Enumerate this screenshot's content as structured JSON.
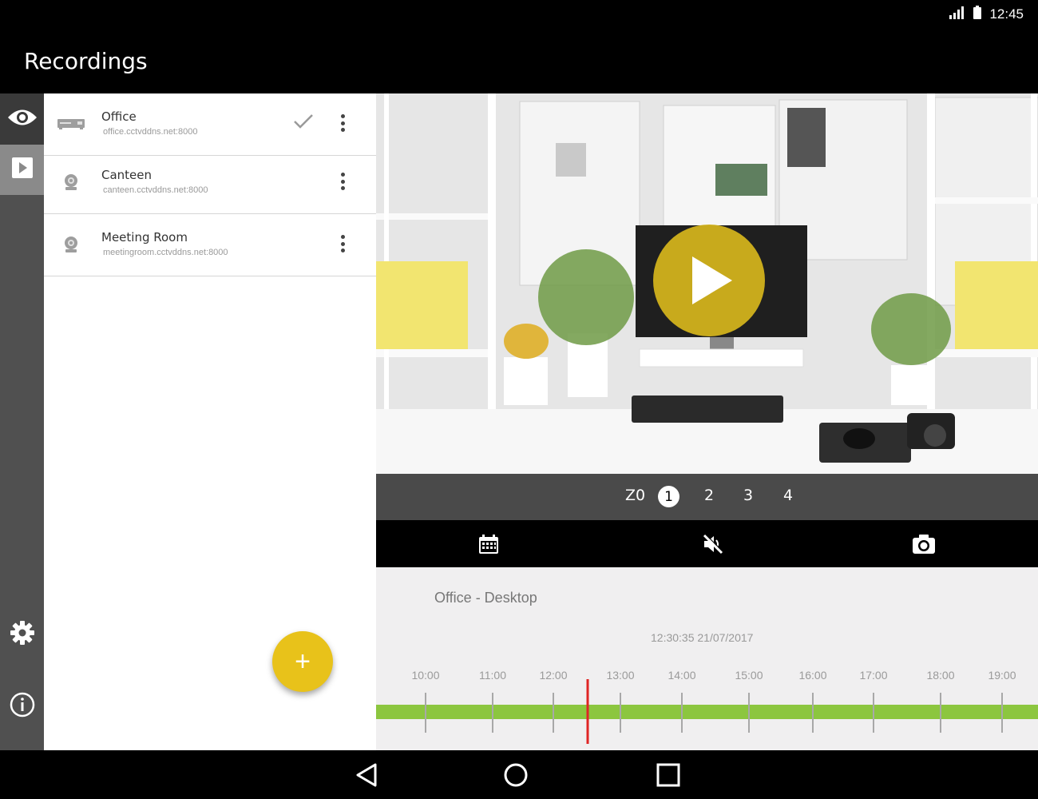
{
  "status_bar": {
    "time": "12:45",
    "icons": [
      "signal-icon",
      "battery-icon"
    ]
  },
  "app_bar": {
    "title": "Recordings"
  },
  "nav_rail": {
    "items": [
      "eye-icon",
      "play-icon",
      "gear-icon",
      "info-icon"
    ]
  },
  "cameras": [
    {
      "name": "Office",
      "host": "office.cctvddns.net:8000",
      "icon": "dvr-icon",
      "selected": true
    },
    {
      "name": "Canteen",
      "host": "canteen.cctvddns.net:8000",
      "icon": "webcam-icon",
      "selected": false
    },
    {
      "name": "Meeting Room",
      "host": "meetingroom.cctvddns.net:8000",
      "icon": "webcam-icon",
      "selected": false
    }
  ],
  "fab": {
    "label": "+"
  },
  "channels": {
    "zoom_label": "Z0",
    "items": [
      "1",
      "2",
      "3",
      "4"
    ],
    "active": "1"
  },
  "toolbar": {
    "icons": [
      "calendar-icon",
      "mute-icon",
      "camera-icon"
    ]
  },
  "timeline": {
    "title": "Office - Desktop",
    "current_time": "12:30:35  21/07/2017",
    "hours": [
      "10:00",
      "11:00",
      "12:00",
      "13:00",
      "14:00",
      "15:00",
      "16:00",
      "17:00",
      "18:00",
      "19:00"
    ],
    "bar_color": "#8cc63f",
    "cursor_color": "#e02424"
  },
  "colors": {
    "accent": "#e8c21a"
  }
}
